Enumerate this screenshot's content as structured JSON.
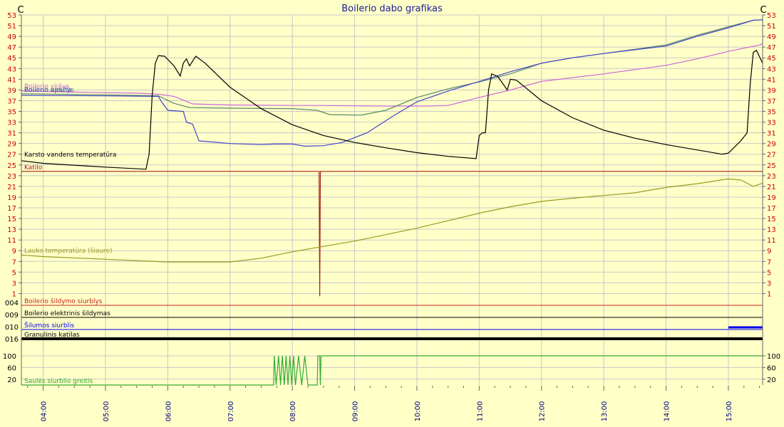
{
  "chart_data": {
    "type": "line",
    "title": "Boilerio  dabo grafikas",
    "y_unit_left": "C",
    "y_unit_right": "C",
    "temperature_panel": {
      "ylim": [
        0,
        53
      ],
      "yticks": [
        1,
        3,
        5,
        7,
        9,
        11,
        13,
        15,
        17,
        19,
        21,
        23,
        25,
        27,
        29,
        31,
        33,
        35,
        37,
        39,
        41,
        43,
        45,
        47,
        49,
        51,
        53
      ],
      "series": [
        {
          "name": "Boilerio viršus",
          "color": "#cc66dd",
          "points": [
            [
              3.65,
              38.8
            ],
            [
              4.5,
              38.6
            ],
            [
              5.5,
              38.4
            ],
            [
              5.85,
              38.2
            ],
            [
              6.1,
              37.8
            ],
            [
              6.4,
              36.4
            ],
            [
              7.0,
              36.2
            ],
            [
              8.0,
              36.1
            ],
            [
              8.4,
              36.1
            ],
            [
              9.5,
              36.0
            ],
            [
              10.2,
              36.0
            ],
            [
              10.5,
              36.1
            ],
            [
              11.0,
              37.6
            ],
            [
              11.5,
              39.0
            ],
            [
              12.0,
              40.6
            ],
            [
              13.0,
              42.0
            ],
            [
              14.0,
              43.6
            ],
            [
              14.5,
              44.8
            ],
            [
              15.0,
              46.2
            ],
            [
              15.5,
              47.4
            ],
            [
              15.55,
              47.6
            ]
          ]
        },
        {
          "name": "Boilerio vidurys",
          "color": "#558866",
          "points": [
            [
              3.65,
              38.3
            ],
            [
              5.0,
              38.1
            ],
            [
              5.85,
              37.9
            ],
            [
              6.1,
              36.5
            ],
            [
              6.35,
              35.7
            ],
            [
              7.0,
              35.6
            ],
            [
              8.0,
              35.5
            ],
            [
              8.4,
              35.2
            ],
            [
              8.6,
              34.4
            ],
            [
              9.1,
              34.3
            ],
            [
              9.5,
              35.2
            ],
            [
              10.0,
              37.6
            ],
            [
              10.5,
              39.2
            ],
            [
              11.0,
              40.5
            ],
            [
              11.5,
              42.0
            ],
            [
              12.0,
              44.0
            ],
            [
              12.5,
              45.0
            ],
            [
              13.0,
              45.8
            ],
            [
              14.0,
              47.4
            ],
            [
              14.5,
              49.2
            ],
            [
              15.0,
              50.8
            ],
            [
              15.4,
              52.0
            ],
            [
              15.55,
              52.1
            ]
          ]
        },
        {
          "name": "Boilerio apačia",
          "color": "#4444cc",
          "points": [
            [
              3.65,
              38.0
            ],
            [
              5.0,
              37.9
            ],
            [
              5.85,
              37.8
            ],
            [
              5.9,
              36.8
            ],
            [
              6.0,
              35.2
            ],
            [
              6.25,
              35.0
            ],
            [
              6.3,
              33.0
            ],
            [
              6.4,
              32.6
            ],
            [
              6.5,
              29.5
            ],
            [
              7.0,
              29.0
            ],
            [
              7.5,
              28.8
            ],
            [
              7.7,
              28.9
            ],
            [
              8.0,
              28.9
            ],
            [
              8.2,
              28.5
            ],
            [
              8.5,
              28.6
            ],
            [
              8.8,
              29.2
            ],
            [
              9.2,
              31.0
            ],
            [
              9.6,
              34.0
            ],
            [
              10.0,
              36.8
            ],
            [
              10.5,
              38.8
            ],
            [
              11.0,
              40.6
            ],
            [
              11.5,
              42.4
            ],
            [
              12.0,
              44.0
            ],
            [
              12.5,
              45.0
            ],
            [
              13.0,
              45.8
            ],
            [
              13.5,
              46.5
            ],
            [
              14.0,
              47.2
            ],
            [
              14.5,
              49.0
            ],
            [
              15.0,
              50.6
            ],
            [
              15.4,
              52.0
            ],
            [
              15.55,
              52.1
            ]
          ]
        },
        {
          "name": "Karsto vandens temperatūra",
          "color": "#000000",
          "points": [
            [
              3.65,
              25.8
            ],
            [
              4.0,
              25.3
            ],
            [
              5.0,
              24.6
            ],
            [
              5.65,
              24.2
            ],
            [
              5.7,
              27.0
            ],
            [
              5.75,
              38.0
            ],
            [
              5.8,
              44.0
            ],
            [
              5.85,
              45.4
            ],
            [
              5.95,
              45.3
            ],
            [
              6.1,
              43.5
            ],
            [
              6.2,
              41.6
            ],
            [
              6.25,
              44.0
            ],
            [
              6.3,
              44.8
            ],
            [
              6.35,
              43.5
            ],
            [
              6.45,
              45.3
            ],
            [
              6.6,
              44.0
            ],
            [
              7.0,
              39.5
            ],
            [
              7.5,
              35.5
            ],
            [
              8.0,
              32.5
            ],
            [
              8.5,
              30.5
            ],
            [
              9.0,
              29.2
            ],
            [
              9.5,
              28.2
            ],
            [
              10.0,
              27.3
            ],
            [
              10.5,
              26.6
            ],
            [
              10.95,
              26.2
            ],
            [
              11.0,
              30.5
            ],
            [
              11.05,
              31.0
            ],
            [
              11.1,
              31.0
            ],
            [
              11.15,
              39.0
            ],
            [
              11.2,
              42.0
            ],
            [
              11.3,
              41.5
            ],
            [
              11.45,
              39.0
            ],
            [
              11.5,
              41.0
            ],
            [
              11.6,
              40.8
            ],
            [
              12.0,
              37.0
            ],
            [
              12.5,
              33.8
            ],
            [
              13.0,
              31.5
            ],
            [
              13.5,
              30.0
            ],
            [
              14.0,
              28.8
            ],
            [
              14.5,
              27.8
            ],
            [
              14.9,
              27.0
            ],
            [
              15.0,
              27.2
            ],
            [
              15.2,
              29.5
            ],
            [
              15.3,
              31.0
            ],
            [
              15.35,
              40.0
            ],
            [
              15.4,
              46.0
            ],
            [
              15.45,
              46.4
            ],
            [
              15.55,
              44.0
            ]
          ]
        },
        {
          "name": "Katilo",
          "color": "#aa2222",
          "points": [
            [
              3.65,
              23.8
            ],
            [
              8.43,
              23.8
            ],
            [
              8.44,
              0.5
            ],
            [
              8.45,
              23.8
            ],
            [
              15.55,
              23.8
            ]
          ]
        },
        {
          "name": "Lauko temperatūra (šiaure)",
          "color": "#999922",
          "points": [
            [
              3.65,
              8.2
            ],
            [
              4.0,
              7.9
            ],
            [
              5.0,
              7.4
            ],
            [
              6.0,
              6.9
            ],
            [
              7.0,
              6.9
            ],
            [
              7.5,
              7.6
            ],
            [
              8.0,
              8.8
            ],
            [
              8.5,
              9.8
            ],
            [
              9.0,
              10.8
            ],
            [
              9.5,
              12.0
            ],
            [
              10.0,
              13.2
            ],
            [
              10.5,
              14.6
            ],
            [
              11.0,
              16.0
            ],
            [
              11.5,
              17.2
            ],
            [
              12.0,
              18.2
            ],
            [
              12.5,
              18.8
            ],
            [
              13.0,
              19.3
            ],
            [
              13.5,
              19.8
            ],
            [
              14.0,
              20.8
            ],
            [
              14.5,
              21.5
            ],
            [
              15.0,
              22.4
            ],
            [
              15.2,
              22.2
            ],
            [
              15.4,
              21.0
            ],
            [
              15.55,
              21.6
            ]
          ]
        }
      ]
    },
    "status_panel": {
      "rows": [
        {
          "name": "Boilerio šildymo  siurblys",
          "code": "004",
          "color": "#cc2222"
        },
        {
          "name": "Boilerio elektrinis šildymas",
          "code": "009",
          "color": "#000000"
        },
        {
          "name": "Šilumos siurblis",
          "code": "010",
          "color": "#0000ee",
          "active_from": 15.0
        },
        {
          "name": "Granulinis katilas",
          "code": "016",
          "color": "#000000",
          "active_from": 3.65
        }
      ]
    },
    "pump_panel": {
      "name": "Saulės siurblio greitis",
      "color": "#33aa33",
      "yticks": [
        20,
        60,
        100
      ],
      "points": [
        [
          3.65,
          0
        ],
        [
          7.7,
          0
        ],
        [
          7.71,
          100
        ],
        [
          7.74,
          0
        ],
        [
          7.78,
          100
        ],
        [
          7.81,
          0
        ],
        [
          7.84,
          100
        ],
        [
          7.87,
          0
        ],
        [
          7.9,
          100
        ],
        [
          7.93,
          0
        ],
        [
          7.96,
          100
        ],
        [
          7.99,
          0
        ],
        [
          8.02,
          100
        ],
        [
          8.05,
          0
        ],
        [
          8.1,
          100
        ],
        [
          8.15,
          0
        ],
        [
          8.2,
          100
        ],
        [
          8.25,
          0
        ],
        [
          8.3,
          0
        ],
        [
          8.4,
          0
        ],
        [
          8.41,
          100
        ],
        [
          8.44,
          100
        ],
        [
          8.45,
          0
        ],
        [
          8.46,
          100
        ],
        [
          15.55,
          100
        ]
      ]
    },
    "x_axis": {
      "range": [
        3.65,
        15.55
      ],
      "ticks": [
        [
          "04:00",
          4
        ],
        [
          "05:00",
          5
        ],
        [
          "06:00",
          6
        ],
        [
          "07:00",
          7
        ],
        [
          "08:00",
          8
        ],
        [
          "09:00",
          9
        ],
        [
          "10:00",
          10
        ],
        [
          "11:00",
          11
        ],
        [
          "12:00",
          12
        ],
        [
          "13:00",
          13
        ],
        [
          "14:00",
          14
        ],
        [
          "15:00",
          15
        ]
      ]
    },
    "colors": {
      "background": "#ffffc8",
      "grid": "#c8c8c8",
      "tick_text": "#cc0000",
      "axis_text": "#000080"
    }
  }
}
